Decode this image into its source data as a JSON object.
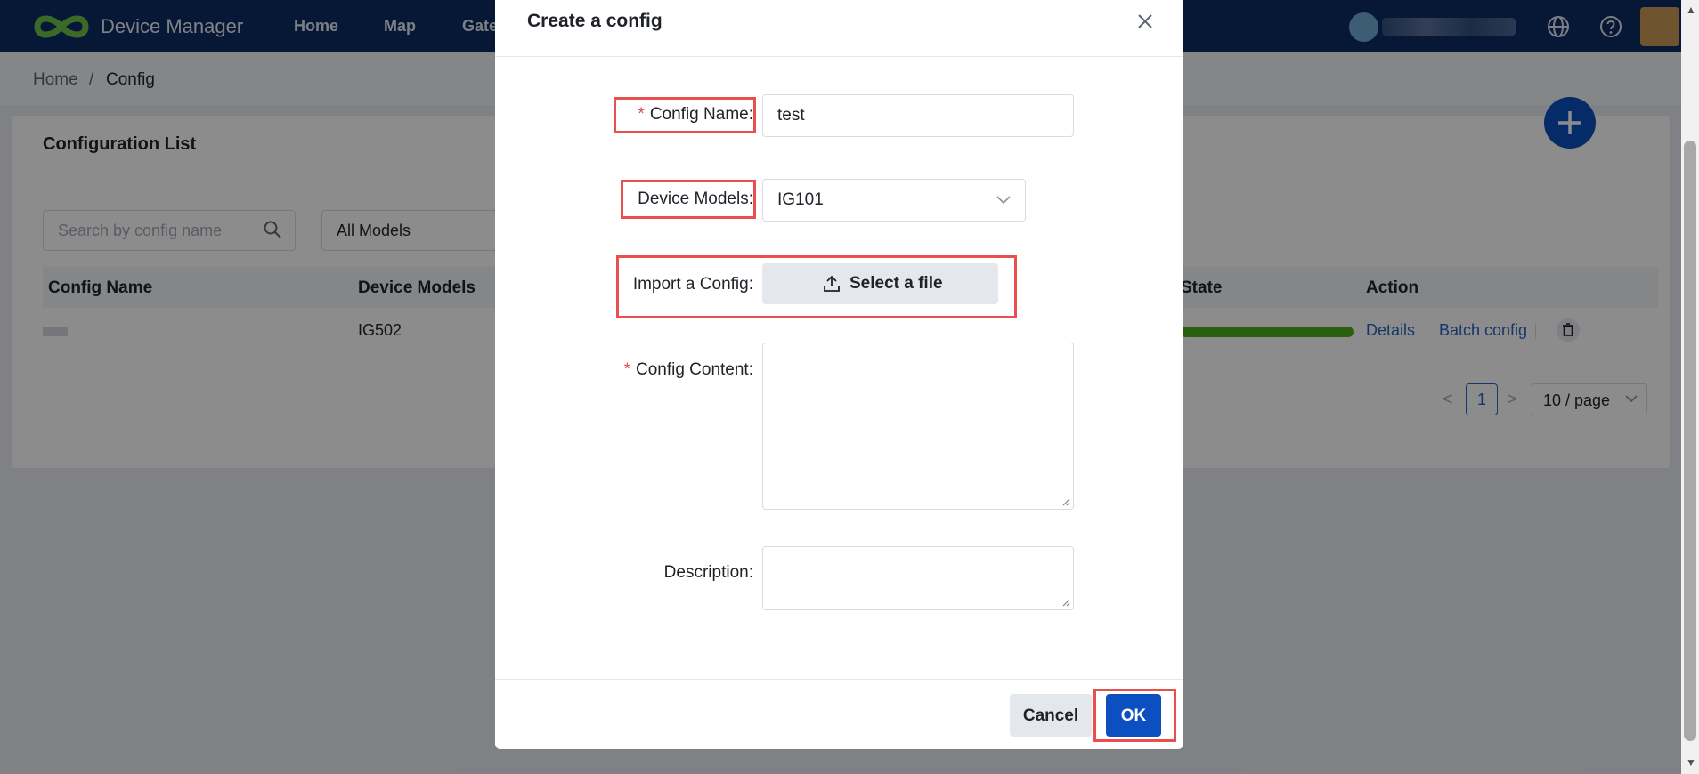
{
  "app": {
    "title": "Device Manager"
  },
  "nav": {
    "items": [
      {
        "label": "Home"
      },
      {
        "label": "Map"
      },
      {
        "label": "Gate"
      }
    ]
  },
  "breadcrumb": {
    "home": "Home",
    "separator": "/",
    "current": "Config"
  },
  "card": {
    "title": "Configuration List"
  },
  "filters": {
    "search_placeholder": "Search by config name",
    "models_value": "All Models"
  },
  "table": {
    "headers": {
      "config_name": "Config Name",
      "device_models": "Device Models",
      "state": "State",
      "action": "Action"
    },
    "rows": [
      {
        "device_model": "IG502",
        "actions": {
          "details": "Details",
          "batch": "Batch config"
        }
      }
    ]
  },
  "pagination": {
    "prev": "<",
    "page": "1",
    "next": ">",
    "page_size": "10 / page"
  },
  "modal": {
    "title": "Create a config",
    "fields": {
      "config_name": {
        "label": "Config Name",
        "value": "test",
        "required": true
      },
      "device_models": {
        "label": "Device Models",
        "value": "IG101"
      },
      "import": {
        "label": "Import a Config",
        "button": "Select a file"
      },
      "config_content": {
        "label": "Config Content",
        "required": true,
        "value": ""
      },
      "description": {
        "label": "Description",
        "value": ""
      }
    },
    "colon": ":",
    "required_mark": "*",
    "footer": {
      "cancel": "Cancel",
      "ok": "OK"
    }
  },
  "colors": {
    "primary": "#0c4fc0",
    "nav_bg": "#0d2d63",
    "highlight": "#e94f4f",
    "state_green": "#4caf1d",
    "required": "#e5484d"
  }
}
